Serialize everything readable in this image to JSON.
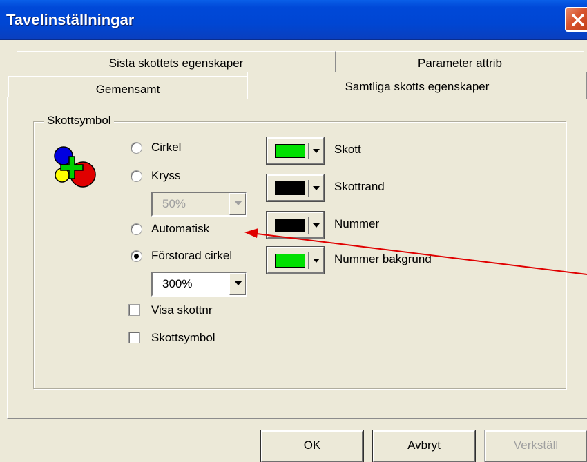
{
  "window": {
    "title": "Tavelinställningar"
  },
  "tabs": {
    "row1": [
      {
        "label": "Sista skottets egenskaper"
      },
      {
        "label": "Parameter attrib"
      }
    ],
    "row2": [
      {
        "label": "Gemensamt"
      },
      {
        "label": "Samtliga skotts egenskaper",
        "active": true
      }
    ]
  },
  "group": {
    "title": "Skottsymbol",
    "radios": [
      {
        "label": "Cirkel",
        "checked": false
      },
      {
        "label": "Kryss",
        "checked": false
      },
      {
        "label": "Automatisk",
        "checked": false
      },
      {
        "label": "Förstorad cirkel",
        "checked": true
      }
    ],
    "kryss_size": {
      "value": "50%",
      "disabled": true
    },
    "circle_size": {
      "value": "300%",
      "disabled": false
    },
    "checkboxes": [
      {
        "label": "Visa skottnr",
        "checked": false
      },
      {
        "label": "Skottsymbol",
        "checked": false
      }
    ],
    "colors": [
      {
        "label": "Skott",
        "color": "#00e000"
      },
      {
        "label": "Skottrand",
        "color": "#000000"
      },
      {
        "label": "Nummer",
        "color": "#000000"
      },
      {
        "label": "Nummer bakgrund",
        "color": "#00e000"
      }
    ],
    "symbol_icon": "colored-circles-plus-icon"
  },
  "buttons": {
    "ok": "OK",
    "cancel": "Avbryt",
    "apply": "Verkställ"
  },
  "annotation": {
    "type": "arrow",
    "color": "#e00000",
    "points_to": "Automatisk"
  }
}
